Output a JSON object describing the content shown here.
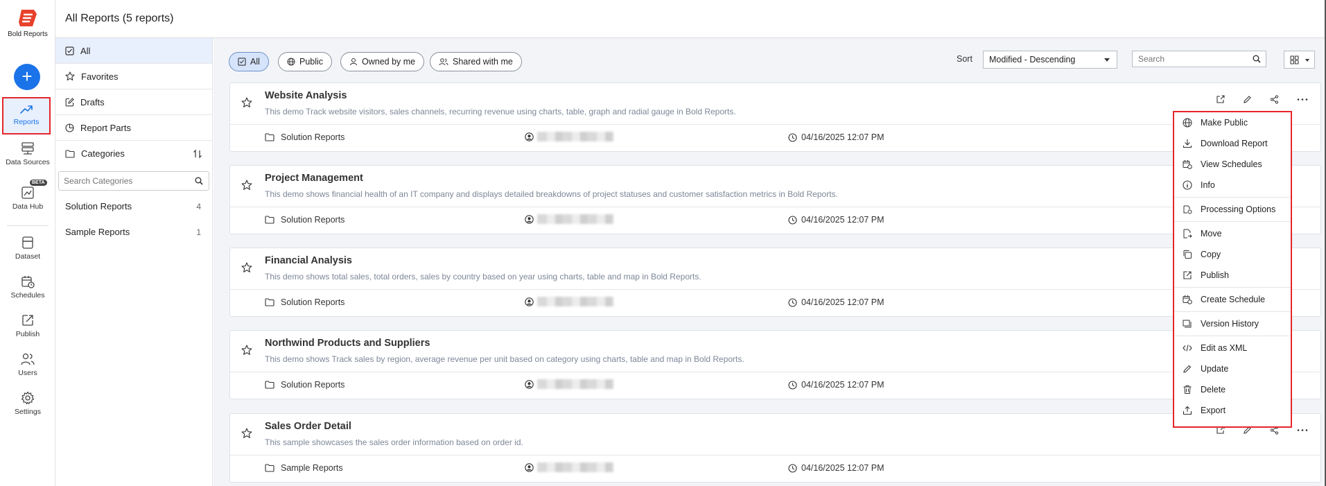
{
  "brand": {
    "name": "Bold Reports",
    "accent": "#e8412b"
  },
  "nav": {
    "reports": "Reports",
    "data_sources": "Data Sources",
    "data_hub": "Data Hub",
    "beta": "BETA",
    "dataset": "Dataset",
    "schedules": "Schedules",
    "publish": "Publish",
    "users": "Users",
    "settings": "Settings",
    "add_label": "+"
  },
  "header": {
    "title": "All Reports (5 reports)"
  },
  "categories": {
    "all": "All",
    "favorites": "Favorites",
    "drafts": "Drafts",
    "report_parts": "Report Parts",
    "categories": "Categories",
    "search_placeholder": "Search Categories",
    "folders": [
      {
        "name": "Solution Reports",
        "count": "4"
      },
      {
        "name": "Sample Reports",
        "count": "1"
      }
    ]
  },
  "filters": {
    "all": "All",
    "public": "Public",
    "owned": "Owned by me",
    "shared": "Shared with me"
  },
  "toolbar": {
    "sort_label": "Sort",
    "sort_value": "Modified - Descending",
    "search_placeholder": "Search"
  },
  "reports": [
    {
      "title": "Website Analysis",
      "desc": "This demo Track website visitors, sales channels, recurring revenue using charts, table, graph and radial gauge in Bold Reports.",
      "category": "Solution Reports",
      "modified": "04/16/2025 12:07 PM"
    },
    {
      "title": "Project Management",
      "desc": "This demo shows financial health of an IT company and displays detailed breakdowns of project statuses and customer satisfaction metrics in Bold Reports.",
      "category": "Solution Reports",
      "modified": "04/16/2025 12:07 PM"
    },
    {
      "title": "Financial Analysis",
      "desc": "This demo shows total sales, total orders, sales by country based on year using charts, table and map in Bold Reports.",
      "category": "Solution Reports",
      "modified": "04/16/2025 12:07 PM"
    },
    {
      "title": "Northwind Products and Suppliers",
      "desc": "This demo shows Track sales by region, average revenue per unit based on category using charts, table and map in Bold Reports.",
      "category": "Solution Reports",
      "modified": "04/16/2025 12:07 PM"
    },
    {
      "title": "Sales Order Detail",
      "desc": "This sample showcases the sales order information based on order id.",
      "category": "Sample Reports",
      "modified": "04/16/2025 12:07 PM"
    }
  ],
  "menu": {
    "make_public": "Make Public",
    "download": "Download Report",
    "view_schedules": "View Schedules",
    "info": "Info",
    "processing": "Processing Options",
    "move": "Move",
    "copy": "Copy",
    "publish": "Publish",
    "create_schedule": "Create Schedule",
    "version_history": "Version History",
    "edit_xml": "Edit as XML",
    "update": "Update",
    "delete": "Delete",
    "export": "Export"
  }
}
